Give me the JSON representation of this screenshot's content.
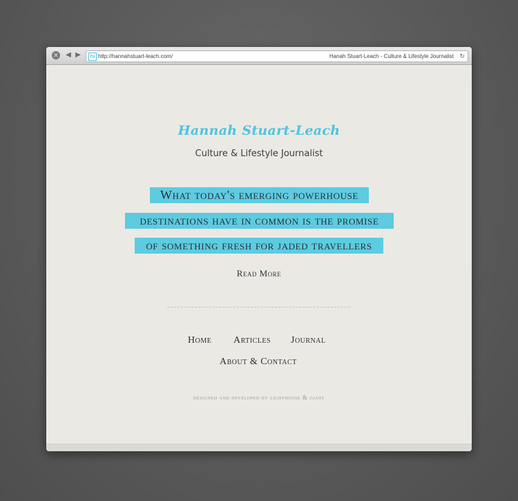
{
  "browser": {
    "url": "http://hannahstuart-leach.com/",
    "title": "Hanah Stuart-Leach - Culture & Lifestyle Journalist",
    "favicon_text": "hl",
    "controls": {
      "close": "✕",
      "back": "◀",
      "forward": "▶",
      "reload": "↻"
    }
  },
  "site": {
    "name": "Hannah Stuart-Leach",
    "tagline": "Culture & Lifestyle Journalist"
  },
  "feature": {
    "lines": [
      "What today's emerging powerhouse",
      "destinations have in common is the promise",
      "of something fresh for jaded travellers"
    ],
    "read_more": "Read More"
  },
  "nav": {
    "items": [
      "Home",
      "Articles",
      "Journal",
      "About & Contact"
    ]
  },
  "footer": {
    "credit": "designed and developed by lighthouse & giant"
  },
  "colors": {
    "accent": "#5dcbe0",
    "page_background": "#ebe9e4",
    "desktop": "#5a5a5a"
  }
}
